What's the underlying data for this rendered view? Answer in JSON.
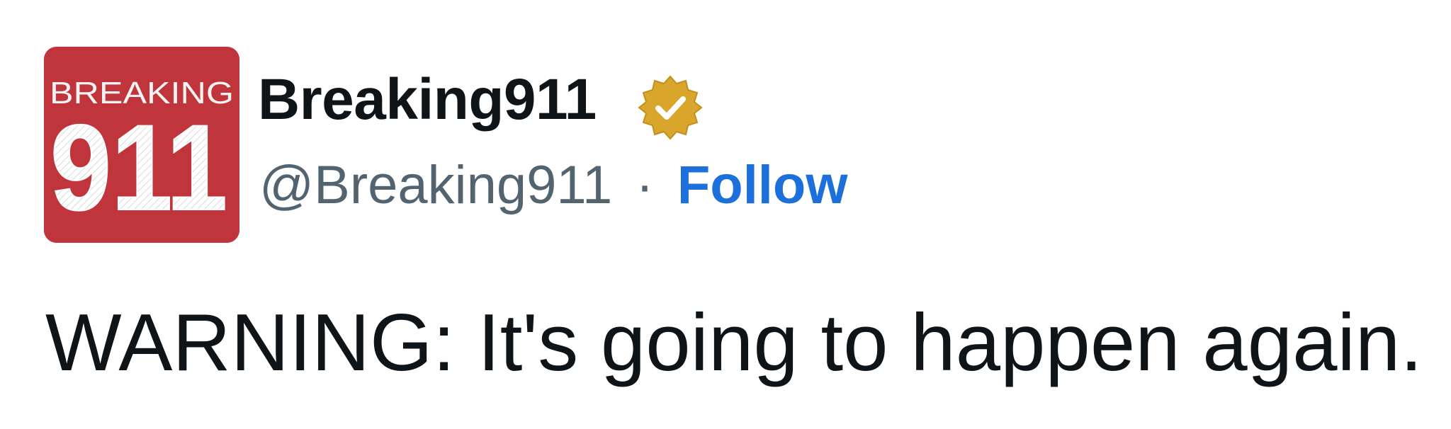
{
  "author": {
    "avatar_label_top": "BREAKING",
    "avatar_label_main": "911",
    "display_name": "Breaking911",
    "handle": "@Breaking911",
    "separator": "·",
    "follow_label": "Follow",
    "verified_icon": "verified-badge-icon"
  },
  "tweet": {
    "text": "WARNING: It's going to happen again."
  },
  "colors": {
    "avatar_bg": "#c0353b",
    "follow": "#1d6fdb",
    "handle": "#536471",
    "badge": "#d9a62b"
  }
}
